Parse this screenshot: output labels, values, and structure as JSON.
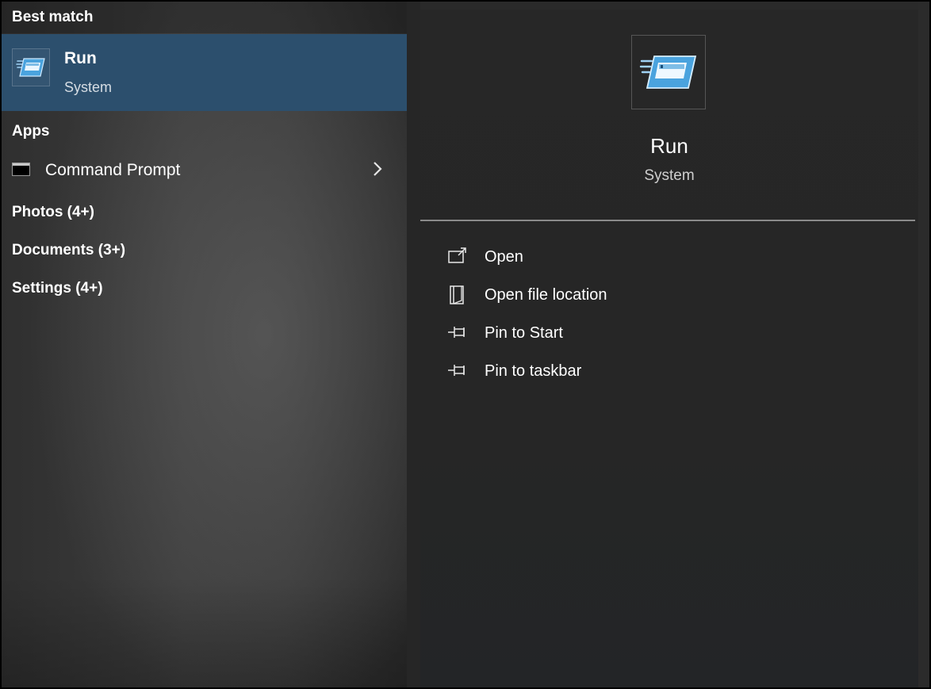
{
  "results": {
    "best_match_header": "Best match",
    "best_match": {
      "title": "Run",
      "subtitle": "System",
      "icon": "run-app-icon"
    },
    "apps_header": "Apps",
    "apps": [
      {
        "label": "Command Prompt",
        "icon": "command-prompt-icon",
        "chevron": "chevron-right-icon"
      }
    ],
    "categories": [
      {
        "label": "Photos (4+)"
      },
      {
        "label": "Documents (3+)"
      },
      {
        "label": "Settings (4+)"
      }
    ]
  },
  "detail": {
    "title": "Run",
    "subtitle": "System",
    "icon": "run-app-icon",
    "actions": [
      {
        "label": "Open",
        "icon": "open-icon"
      },
      {
        "label": "Open file location",
        "icon": "file-location-icon"
      },
      {
        "label": "Pin to Start",
        "icon": "pin-icon"
      },
      {
        "label": "Pin to taskbar",
        "icon": "pin-icon"
      }
    ]
  },
  "colors": {
    "selected_bg": "#2c4f6d",
    "pane_bg": "#272727",
    "divider": "#8a8a8a"
  }
}
